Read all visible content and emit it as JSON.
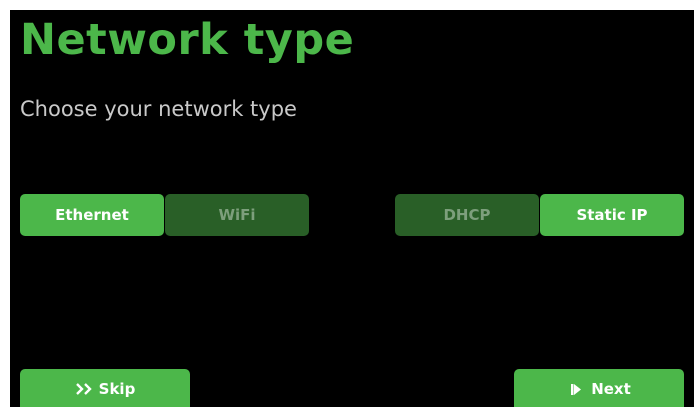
{
  "page": {
    "title": "Network type",
    "subtitle": "Choose your network type"
  },
  "connection": {
    "options": [
      {
        "label": "Ethernet",
        "selected": true
      },
      {
        "label": "WiFi",
        "selected": false
      }
    ]
  },
  "addressing": {
    "options": [
      {
        "label": "DHCP",
        "selected": false
      },
      {
        "label": "Static IP",
        "selected": true
      }
    ]
  },
  "footer": {
    "skip_label": "Skip",
    "skip_icon": "fast-forward-icon",
    "next_label": "Next",
    "next_icon": "skip-next-icon"
  },
  "colors": {
    "background": "#000000",
    "accent": "#4cb74a",
    "inactive": "#295f27",
    "inactive_text": "#7d9f7c",
    "subtitle_text": "#c9c9c9"
  }
}
